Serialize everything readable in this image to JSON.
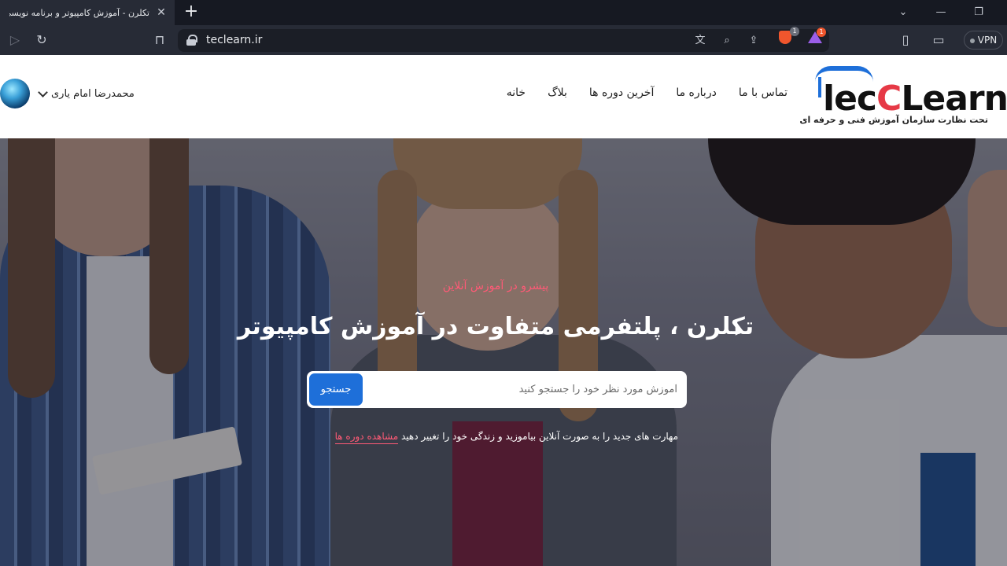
{
  "browser": {
    "tab_title": "تکلرن - آموزش کامپیوتر و برنامه نویسی",
    "url": "teclearn.ir",
    "vpn_label": "VPN",
    "brave_badge": "1",
    "rewards_badge": "1",
    "icons": [
      "close-icon",
      "plus-icon",
      "chevron-down-icon",
      "minimize-icon",
      "restore-icon",
      "play-icon",
      "reload-icon",
      "bookmark-icon",
      "lock-icon",
      "translate-icon",
      "zoom-icon",
      "share-icon",
      "brave-shields-icon",
      "brave-rewards-icon",
      "sidebar-icon",
      "wallet-icon"
    ]
  },
  "site": {
    "logo_text_1": "lec",
    "logo_text_c": "C",
    "logo_text_2": "Learn",
    "logo_sub": "تحت نظارت سازمان آموزش فنی و حرفه ای",
    "nav": [
      "خانه",
      "بلاگ",
      "آخرین دوره ها",
      "درباره ما",
      "تماس با ما"
    ],
    "user_name": "محمدرضا امام یاری"
  },
  "hero": {
    "tagline": "پیشرو در آموزش آنلاین",
    "title": "تکلرن ، پلتفرمی متفاوت در آموزش کامپیوتر",
    "search_placeholder": "آموزش مورد نظر خود را جستجو کنید",
    "search_button": "جستجو",
    "subtitle": "مهارت های جدید را به صورت آنلاین بیاموزید و زندگی خود را تغییر دهید",
    "link": "مشاهده دوره ها"
  },
  "colors": {
    "accent": "#1e6fd9",
    "highlight": "#ff5a76",
    "logo_c": "#e63946"
  }
}
